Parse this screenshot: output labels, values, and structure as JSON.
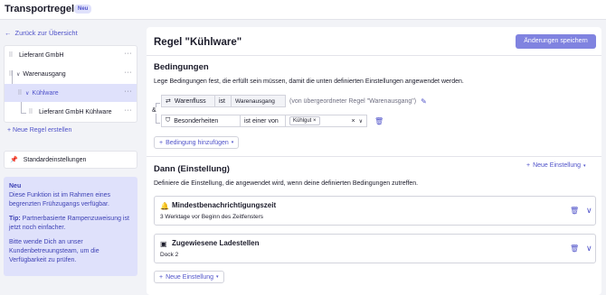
{
  "topbar": {
    "title": "Transportregeln",
    "badge": "Neu"
  },
  "sidebar": {
    "back_link": "Zurück zur Übersicht",
    "tree": [
      {
        "label": "Lieferant GmbH",
        "more": "···"
      },
      {
        "label": "Warenausgang",
        "more": "···"
      },
      {
        "label": "Kühlware",
        "more": "···"
      },
      {
        "label": "Lieferant GmbH Kühlware",
        "more": "···"
      }
    ],
    "new_rule": "+ Neue Regel erstellen",
    "std_settings": "Standardeinstellungen",
    "info": {
      "head": "Neu",
      "p1": "Diese Funktion ist im Rahmen eines begrenzten Frühzugangs verfügbar.",
      "tip_label": "Tip:",
      "p2": " Partnerbasierte Rampenzuweisung ist jetzt noch einfacher.",
      "p3": "Bitte wende Dich an unser Kundenbetreuungsteam, um die Verfügbarkeit zu prüfen."
    }
  },
  "main": {
    "title": "Regel \"Kühlware\"",
    "save_button": "Änderungen speichern",
    "conditions": {
      "title": "Bedingungen",
      "description": "Lege Bedingungen fest, die erfüllt sein müssen, damit die unten definierten Einstellungen angewendet werden.",
      "row1": {
        "field": "Warenfluss",
        "op": "ist",
        "value": "Warenausgang",
        "inherited": "(von übergeordneter Regel \"Warenausgang\")"
      },
      "connector": "&",
      "row2": {
        "field": "Besonderheiten",
        "op": "ist einer von",
        "chip": "Kühlgut",
        "chip_x": "×",
        "clear": "×"
      },
      "add_button": "Bedingung hinzufügen"
    },
    "then": {
      "title": "Dann (Einstellung)",
      "new_setting_link": "Neue Einstellung",
      "description": "Definiere die Einstellung, die angewendet wird, wenn deine definierten Bedingungen zutreffen.",
      "settings": [
        {
          "name": "Mindestbenachrichtigungszeit",
          "sub": "3 Werktage vor Beginn des Zeitfensters",
          "icon": "notification-icon"
        },
        {
          "name": "Zugewiesene Ladestellen",
          "sub": "Dock 2",
          "icon": "dock-icon"
        }
      ],
      "new_setting_button": "Neue Einstellung"
    }
  }
}
